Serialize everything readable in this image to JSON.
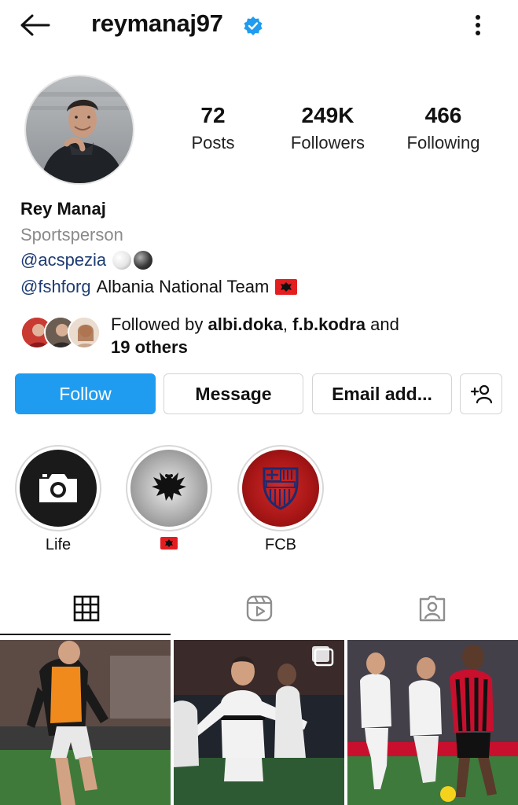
{
  "header": {
    "username": "reymanaj97",
    "verified": true,
    "icons": [
      "back-arrow-icon",
      "verified-badge-icon",
      "more-vertical-icon"
    ]
  },
  "profile": {
    "stats": [
      {
        "value": "72",
        "label": "Posts"
      },
      {
        "value": "249K",
        "label": "Followers"
      },
      {
        "value": "466",
        "label": "Following"
      }
    ],
    "full_name": "Rey Manaj",
    "category": "Sportsperson",
    "bio_line1_mention": "@acspezia",
    "bio_line2_mention": "@fshforg",
    "bio_line2_text": "Albania National Team"
  },
  "followed_by": {
    "prefix": "Followed by",
    "user1": "albi.doka",
    "separator": ",",
    "user2": "f.b.kodra",
    "conjunction": "and",
    "others": "19 others"
  },
  "actions": {
    "follow": "Follow",
    "message": "Message",
    "email": "Email add...",
    "suggest_icon": "add-person-icon"
  },
  "highlights": [
    {
      "label": "Life",
      "icon": "camera-icon"
    },
    {
      "label": "",
      "icon": "albania-flag-icon"
    },
    {
      "label": "FCB",
      "icon": "fcb-crest-icon"
    }
  ],
  "tabs": [
    {
      "name": "grid",
      "icon": "grid-icon",
      "active": true
    },
    {
      "name": "reels",
      "icon": "reels-icon",
      "active": false
    },
    {
      "name": "tagged",
      "icon": "tagged-person-icon",
      "active": false
    }
  ],
  "colors": {
    "follow_blue": "#1f9cf0",
    "verified_blue": "#1f9cf0",
    "mention_blue": "#1d3b73",
    "spezia_white": "#ffffff",
    "milan_red": "#c8102e"
  }
}
